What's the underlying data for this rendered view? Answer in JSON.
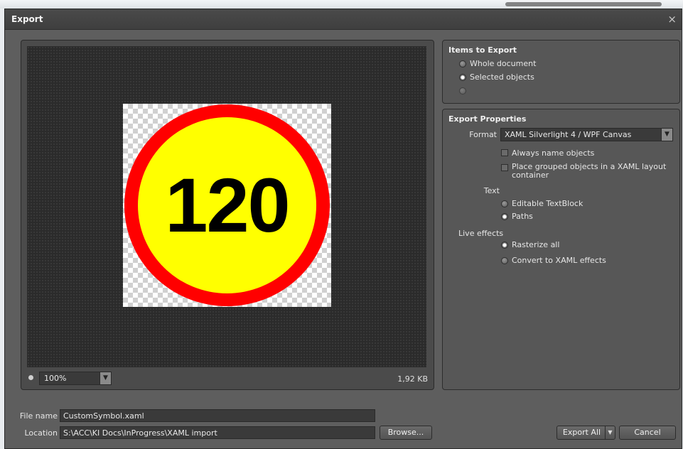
{
  "dialog": {
    "title": "Export",
    "close_glyph": "×"
  },
  "preview": {
    "sign_text": "120",
    "zoom": "100%",
    "file_size": "1,92 KB",
    "sign_colors": {
      "ring": "#ff0000",
      "fill": "#ffff00",
      "text": "#000000"
    }
  },
  "items_to_export": {
    "title": "Items to Export",
    "options": [
      {
        "label": "Whole document",
        "selected": false
      },
      {
        "label": "Selected objects",
        "selected": true
      },
      {
        "label": "",
        "selected": false
      }
    ]
  },
  "export_properties": {
    "title": "Export Properties",
    "format_label": "Format",
    "format_value": "XAML Silverlight 4 / WPF Canvas",
    "checkboxes": [
      {
        "label": "Always name objects",
        "checked": false
      },
      {
        "label": "Place grouped objects in a XAML layout container",
        "checked": false
      }
    ],
    "text_label": "Text",
    "text_options": [
      {
        "label": "Editable TextBlock",
        "selected": false
      },
      {
        "label": "Paths",
        "selected": true
      }
    ],
    "live_effects_label": "Live effects",
    "live_effects_options": [
      {
        "label": "Rasterize all",
        "selected": true
      },
      {
        "label": "Convert to XAML effects",
        "selected": false
      }
    ]
  },
  "file": {
    "name_label": "File name",
    "name_value": "CustomSymbol.xaml",
    "location_label": "Location",
    "location_value": "S:\\ACC\\KI Docs\\InProgress\\XAML import"
  },
  "buttons": {
    "browse": "Browse...",
    "export_all": "Export All",
    "cancel": "Cancel"
  },
  "icons": {
    "close": "close-icon",
    "dropdown": "chevron-down-icon",
    "split": "chevron-down-icon"
  },
  "colors": {
    "dialog_bg": "#5e5e5e",
    "panel_bg": "#575757",
    "field_bg": "#3a3a3a",
    "titlebar_bg": "#444444"
  }
}
